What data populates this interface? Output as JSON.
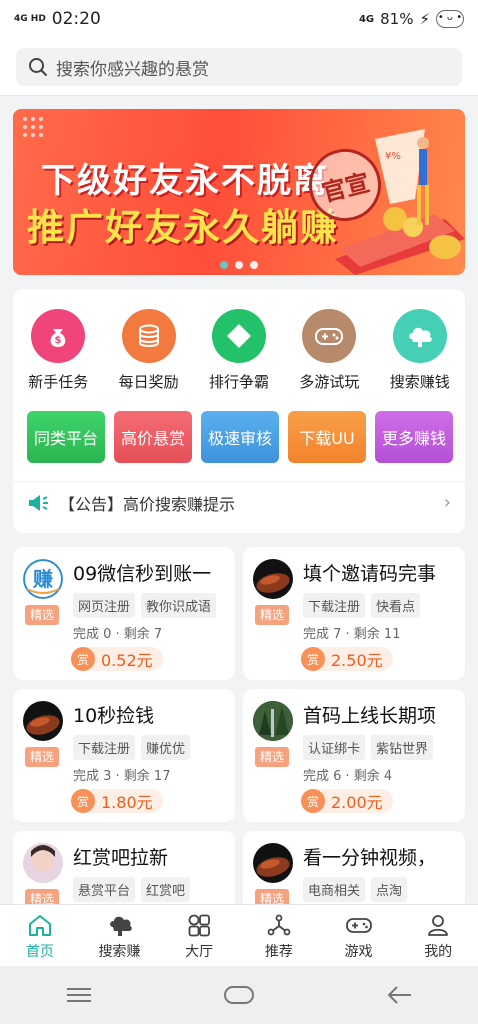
{
  "status": {
    "network": "4G HD",
    "time": "02:20",
    "signal_right": "4G",
    "battery": "81%"
  },
  "search": {
    "placeholder": "搜索你感兴趣的悬赏"
  },
  "banner": {
    "line1": "下级好友永不脱离",
    "line2": "推广好友永久躺赚",
    "stamp": "官宣",
    "page_count": 3,
    "active_page": 1
  },
  "menu": {
    "icons": [
      {
        "label": "新手任务",
        "icon": "money-bag-icon",
        "color": "#f0457a"
      },
      {
        "label": "每日奖励",
        "icon": "coins-icon",
        "color": "#f27a3e"
      },
      {
        "label": "排行争霸",
        "icon": "diamond-icon",
        "color": "#23c26a"
      },
      {
        "label": "多游试玩",
        "icon": "gamepad-icon",
        "color": "#b88a6c"
      },
      {
        "label": "搜索赚钱",
        "icon": "cloud-icon",
        "color": "#45d0b5"
      }
    ],
    "buttons": [
      {
        "label": "同类平台",
        "color": "#35c95e"
      },
      {
        "label": "高价悬赏",
        "color": "#ef5f66"
      },
      {
        "label": "极速审核",
        "color": "#4aa3e6"
      },
      {
        "label": "下载UU",
        "color": "#f6923a"
      },
      {
        "label": "更多赚钱",
        "color": "#c45fe0"
      }
    ],
    "notice": "【公告】高价搜索赚提示"
  },
  "tasks": [
    {
      "title": "09微信秒到账一",
      "badge": "精选",
      "tags": [
        "网页注册",
        "教你识成语"
      ],
      "stats": "完成 0 · 剩余 7",
      "reward_prefix": "赏",
      "reward": "0.52元",
      "avatar": "logo"
    },
    {
      "title": "填个邀请码完事",
      "badge": "精选",
      "tags": [
        "下载注册",
        "快看点"
      ],
      "stats": "完成 7 · 剩余 11",
      "reward_prefix": "赏",
      "reward": "2.50元",
      "avatar": "bean"
    },
    {
      "title": "10秒捡钱",
      "badge": "精选",
      "tags": [
        "下载注册",
        "赚优优"
      ],
      "stats": "完成 3 · 剩余 17",
      "reward_prefix": "赏",
      "reward": "1.80元",
      "avatar": "bean"
    },
    {
      "title": "首码上线长期项",
      "badge": "精选",
      "tags": [
        "认证绑卡",
        "紫钻世界"
      ],
      "stats": "完成 6 · 剩余 4",
      "reward_prefix": "赏",
      "reward": "2.00元",
      "avatar": "forest"
    },
    {
      "title": "红赏吧拉新",
      "badge": "精选",
      "tags": [
        "悬赏平台",
        "红赏吧"
      ],
      "stats": "",
      "reward_prefix": "",
      "reward": "",
      "avatar": "face"
    },
    {
      "title": "看一分钟视频，",
      "badge": "精选",
      "tags": [
        "电商相关",
        "点淘"
      ],
      "stats": "",
      "reward_prefix": "",
      "reward": "",
      "avatar": "bean"
    }
  ],
  "tabs": [
    {
      "label": "首页",
      "icon": "home-icon",
      "active": true
    },
    {
      "label": "搜索赚",
      "icon": "search-earn-icon",
      "active": false
    },
    {
      "label": "大厅",
      "icon": "grid-icon",
      "active": false
    },
    {
      "label": "推荐",
      "icon": "share-icon",
      "active": false
    },
    {
      "label": "游戏",
      "icon": "gamepad-icon",
      "active": false
    },
    {
      "label": "我的",
      "icon": "user-icon",
      "active": false
    }
  ],
  "colors": {
    "accent": "#1bb3a0",
    "reward": "#ef5d1d"
  }
}
